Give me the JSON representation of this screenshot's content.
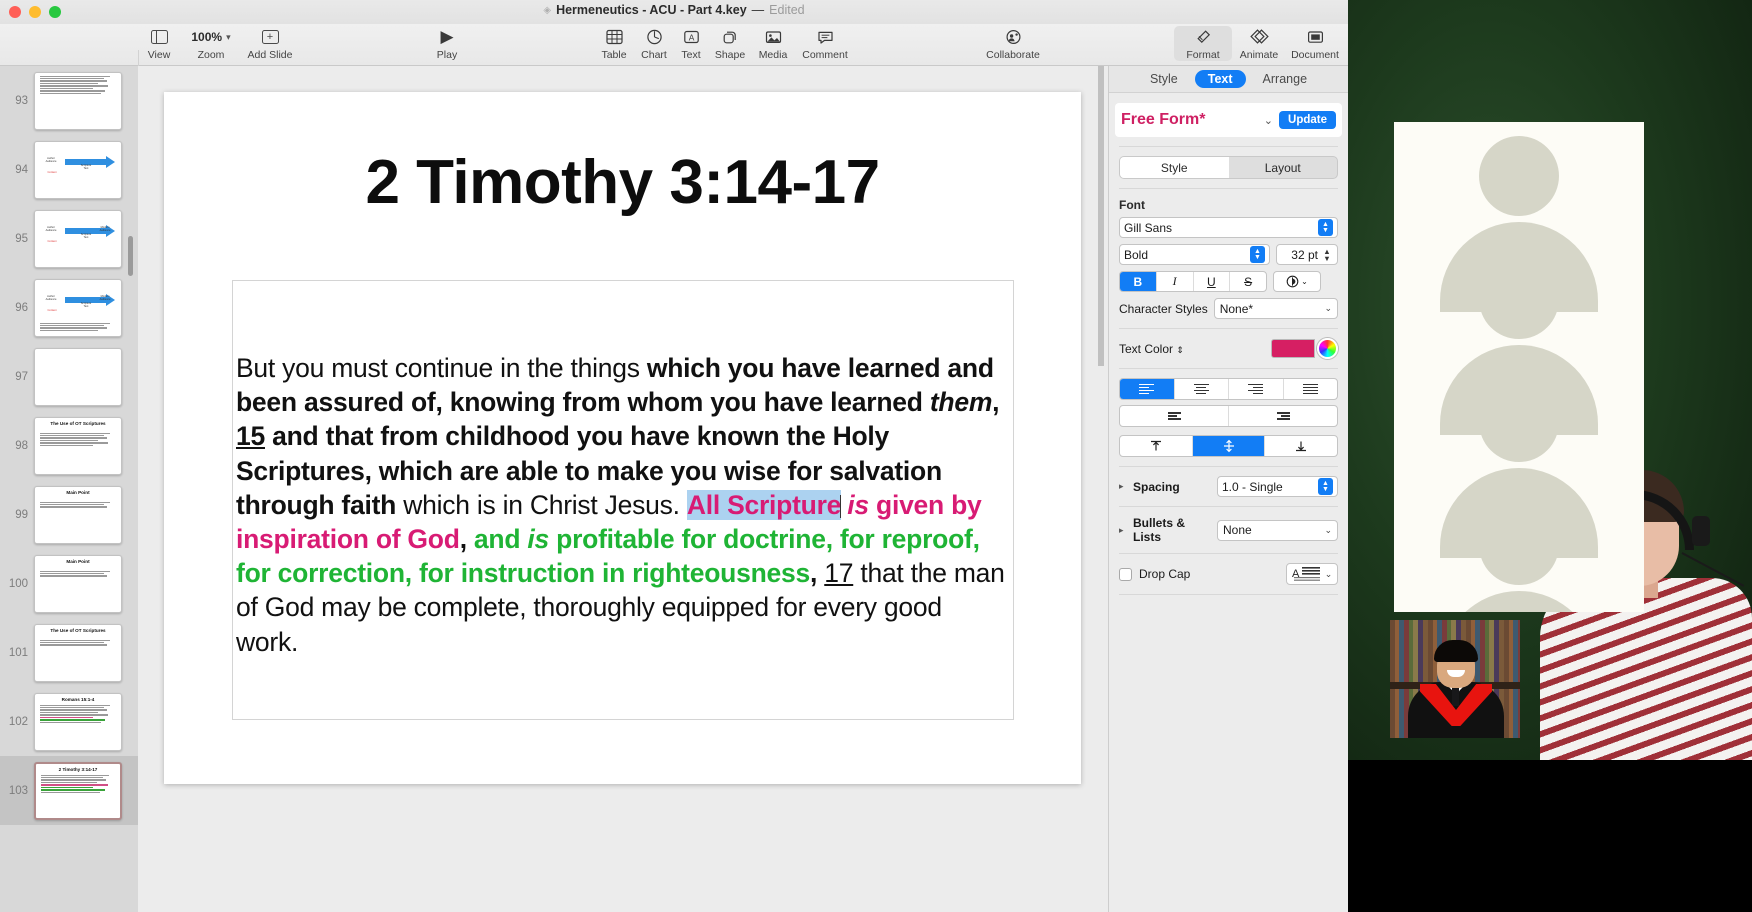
{
  "window": {
    "doc_title": "Hermeneutics - ACU - Part 4.key",
    "doc_separator": "—",
    "doc_edited": "Edited"
  },
  "toolbar": {
    "view_label": "View",
    "zoom_label": "Zoom",
    "zoom_value": "100%",
    "add_slide_label": "Add Slide",
    "play_label": "Play",
    "table_label": "Table",
    "chart_label": "Chart",
    "text_label": "Text",
    "shape_label": "Shape",
    "media_label": "Media",
    "comment_label": "Comment",
    "collaborate_label": "Collaborate",
    "format_label": "Format",
    "animate_label": "Animate",
    "document_label": "Document"
  },
  "inspector": {
    "tabs": [
      {
        "label": "Style",
        "active": false
      },
      {
        "label": "Text",
        "active": true
      },
      {
        "label": "Arrange",
        "active": false
      }
    ],
    "style_name": "Free Form*",
    "update_label": "Update",
    "subtabs": [
      {
        "label": "Style",
        "active": true
      },
      {
        "label": "Layout",
        "active": false
      }
    ],
    "font_section_label": "Font",
    "font_family": "Gill Sans",
    "font_weight": "Bold",
    "font_size": "32 pt",
    "bold_label": "B",
    "italic_label": "I",
    "underline_label": "U",
    "strikethrough_label": "S",
    "character_styles_label": "Character Styles",
    "character_styles_value": "None*",
    "text_color_label": "Text Color",
    "text_color_value": "#d61f63",
    "spacing_label": "Spacing",
    "spacing_value": "1.0 - Single",
    "bullets_label": "Bullets & Lists",
    "bullets_value": "None",
    "drop_cap_label": "Drop Cap",
    "accent_color": "#127df5"
  },
  "navigator": {
    "slides": [
      {
        "number": "93",
        "title": "",
        "kind": "text",
        "selected": false
      },
      {
        "number": "94",
        "title": "",
        "kind": "diagram1",
        "selected": false
      },
      {
        "number": "95",
        "title": "",
        "kind": "diagram2",
        "selected": false
      },
      {
        "number": "96",
        "title": "",
        "kind": "diagram3",
        "selected": false
      },
      {
        "number": "97",
        "title": "",
        "kind": "twocol",
        "selected": false
      },
      {
        "number": "98",
        "title": "The Use of OT Scriptures",
        "kind": "bullets",
        "selected": false
      },
      {
        "number": "99",
        "title": "Main Point",
        "kind": "bullets",
        "selected": false
      },
      {
        "number": "100",
        "title": "Main Point",
        "kind": "bullets",
        "selected": false
      },
      {
        "number": "101",
        "title": "The Use of OT Scriptures",
        "kind": "bullets",
        "selected": false
      },
      {
        "number": "102",
        "title": "Romans 15:1-4",
        "kind": "para",
        "selected": false
      },
      {
        "number": "103",
        "title": "2 Timothy 3:14-17",
        "kind": "para-color",
        "selected": true
      }
    ]
  },
  "slide": {
    "title": "2 Timothy 3:14-17",
    "body_segments": [
      {
        "text": "But you must continue in the things ",
        "style": "plain",
        "color": "black"
      },
      {
        "text": "which you have learned and been assured of, knowing from whom you have learned ",
        "style": "bold",
        "color": "black"
      },
      {
        "text": "them",
        "style": "bold-italic",
        "color": "black"
      },
      {
        "text": ", ",
        "style": "bold",
        "color": "black"
      },
      {
        "text": "15",
        "style": "bold-underline",
        "color": "black"
      },
      {
        "text": " and that from childhood you have known the Holy Scriptures, which are able to make you wise for salvation through faith",
        "style": "bold",
        "color": "black"
      },
      {
        "text": " which is in Christ Jesus.  ",
        "style": "plain",
        "color": "black"
      },
      {
        "text": "All Scripture",
        "style": "bold-selected",
        "color": "pink"
      },
      {
        "text": " is",
        "style": "bold-italic",
        "color": "pink"
      },
      {
        "text": " given by inspiration of God",
        "style": "bold",
        "color": "pink"
      },
      {
        "text": ", ",
        "style": "bold",
        "color": "black"
      },
      {
        "text": "and ",
        "style": "bold",
        "color": "green"
      },
      {
        "text": "is",
        "style": "bold-italic",
        "color": "green"
      },
      {
        "text": " profitable for doctrine, for reproof, for correction, for instruction in righteousness",
        "style": "bold",
        "color": "green"
      },
      {
        "text": ", ",
        "style": "bold",
        "color": "black"
      },
      {
        "text": "17",
        "style": "underline",
        "color": "black"
      },
      {
        "text": " that the man of God may be complete, thoroughly equipped for every good work.",
        "style": "plain",
        "color": "black"
      }
    ],
    "colors": {
      "pink": "#d81b74",
      "green": "#1fb435",
      "selection": "#acd2f0"
    }
  }
}
